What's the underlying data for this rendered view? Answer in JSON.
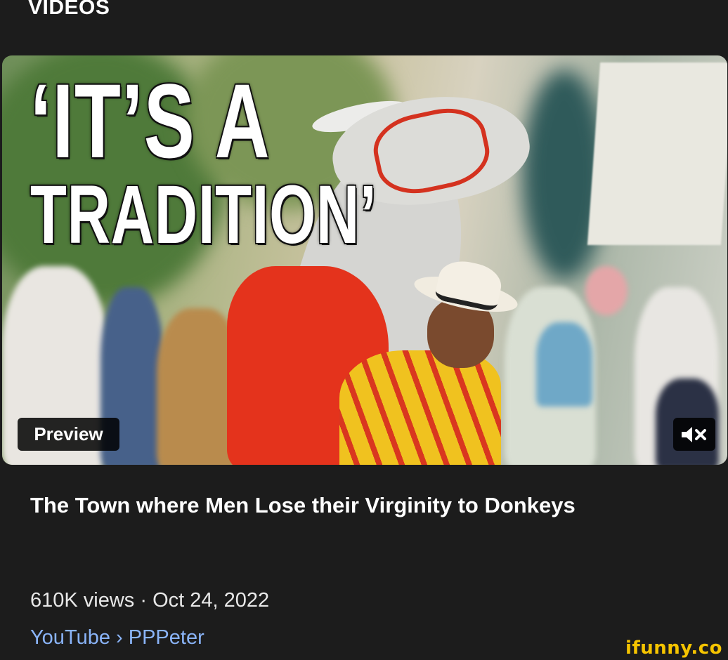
{
  "section": {
    "title": "VIDEOS"
  },
  "video": {
    "thumbnail_text_line1": "‘IT’S A",
    "thumbnail_text_line2": "TRADITION’",
    "preview_label": "Preview",
    "mute_icon": "volume-muted-icon",
    "title": "The Town where Men Lose their Virginity to Donkeys",
    "views_date": "610K views · Oct 24, 2022",
    "source": "YouTube › PPPeter"
  },
  "watermark": "ifunny.co",
  "colors": {
    "background": "#1c1c1c",
    "link": "#8ab4f8",
    "watermark": "#f5c400"
  }
}
